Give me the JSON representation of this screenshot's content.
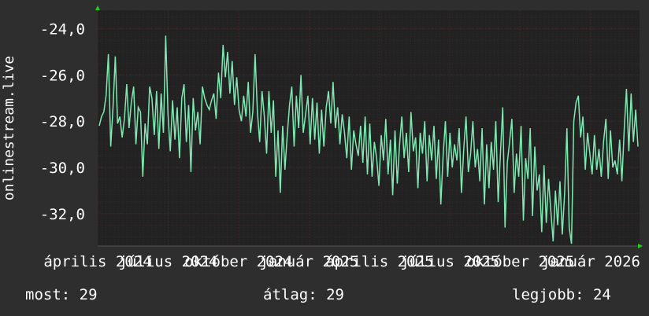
{
  "chart_data": {
    "type": "line",
    "ylabel": "onlinestream.live",
    "ylim": [
      -33.4,
      -23.2
    ],
    "y_ticks": [
      -24,
      -26,
      -28,
      -30,
      -32
    ],
    "y_tick_labels": [
      "-24,0",
      "-26,0",
      "-28,0",
      "-30,0",
      "-32,0"
    ],
    "x_tick_labels": [
      "április 2024",
      "július 2024",
      "október 2024",
      "január 2025",
      "április 2025",
      "július 2025",
      "október 2025",
      "január 2026"
    ],
    "x_ticks": [
      0,
      13,
      26,
      39,
      52,
      65,
      78,
      91
    ],
    "x_range": [
      0,
      100
    ],
    "grid": true,
    "series": [
      {
        "color": "#7fe8b2",
        "values": [
          -28.2,
          -27.8,
          -27.6,
          -26.9,
          -25.1,
          -29.1,
          -27.4,
          -25.2,
          -28.1,
          -27.8,
          -28.7,
          -27.9,
          -26.4,
          -28.3,
          -27.2,
          -26.5,
          -29.0,
          -27.4,
          -27.6,
          -30.4,
          -28.1,
          -29.0,
          -26.5,
          -27.0,
          -28.6,
          -26.7,
          -29.2,
          -26.8,
          -28.5,
          -24.3,
          -27.7,
          -29.3,
          -27.1,
          -28.8,
          -27.4,
          -29.6,
          -27.0,
          -26.4,
          -28.9,
          -27.3,
          -30.2,
          -27.0,
          -28.4,
          -27.6,
          -29.0,
          -26.5,
          -27.0,
          -27.3,
          -27.5,
          -27.1,
          -26.8,
          -27.9,
          -25.9,
          -27.0,
          -24.7,
          -26.1,
          -25.0,
          -26.8,
          -25.4,
          -27.3,
          -26.1,
          -27.5,
          -28.0,
          -26.9,
          -27.8,
          -26.3,
          -28.5,
          -27.6,
          -25.1,
          -27.6,
          -28.9,
          -26.7,
          -27.8,
          -29.4,
          -26.7,
          -28.5,
          -27.1,
          -30.4,
          -28.4,
          -31.1,
          -28.2,
          -30.1,
          -28.6,
          -27.3,
          -26.5,
          -29.1,
          -26.9,
          -28.3,
          -26.0,
          -28.5,
          -27.7,
          -26.9,
          -29.0,
          -27.0,
          -28.8,
          -27.2,
          -29.4,
          -27.5,
          -29.1,
          -27.4,
          -26.7,
          -28.1,
          -26.3,
          -28.3,
          -27.4,
          -29.0,
          -27.7,
          -28.5,
          -29.6,
          -27.8,
          -30.1,
          -28.4,
          -29.0,
          -29.5,
          -28.2,
          -29.8,
          -27.8,
          -30.3,
          -28.1,
          -30.4,
          -28.9,
          -29.6,
          -30.8,
          -28.6,
          -29.7,
          -27.9,
          -30.3,
          -28.8,
          -31.2,
          -28.4,
          -30.7,
          -29.0,
          -27.8,
          -29.6,
          -28.5,
          -30.2,
          -27.6,
          -29.3,
          -28.7,
          -30.9,
          -28.5,
          -29.4,
          -28.0,
          -30.6,
          -28.6,
          -29.7,
          -28.2,
          -30.5,
          -28.8,
          -31.6,
          -29.5,
          -28.0,
          -30.4,
          -28.5,
          -30.0,
          -29.0,
          -29.7,
          -28.3,
          -31.1,
          -29.2,
          -27.8,
          -30.2,
          -29.4,
          -28.0,
          -30.0,
          -29.2,
          -30.6,
          -28.3,
          -31.6,
          -29.0,
          -30.9,
          -28.9,
          -30.1,
          -28.0,
          -31.5,
          -29.4,
          -27.4,
          -32.6,
          -29.8,
          -28.9,
          -27.9,
          -31.1,
          -29.4,
          -30.4,
          -28.2,
          -32.3,
          -29.6,
          -30.5,
          -28.3,
          -32.1,
          -29.1,
          -31.0,
          -30.3,
          -32.8,
          -29.9,
          -32.4,
          -30.5,
          -31.9,
          -33.2,
          -31.0,
          -32.5,
          -30.6,
          -32.9,
          -31.1,
          -28.3,
          -32.6,
          -33.3,
          -28.0,
          -27.2,
          -26.9,
          -28.7,
          -27.8,
          -30.1,
          -28.5,
          -29.4,
          -30.3,
          -28.6,
          -30.1,
          -29.2,
          -30.4,
          -28.9,
          -27.9,
          -30.5,
          -28.4,
          -30.0,
          -29.7,
          -30.3,
          -28.8,
          -30.6,
          -28.4,
          -26.6,
          -29.3,
          -26.8,
          -28.9,
          -27.5,
          -29.1
        ]
      }
    ]
  },
  "footer": {
    "current": "most: 29",
    "average": "átlag: 29",
    "best": "legjobb: 24"
  },
  "colors": {
    "background": "#2e2e2e",
    "plot_background": "#222222",
    "grid_major": "#3f2727",
    "grid_minor": "#332a2a",
    "line": "#7fe8b2",
    "axis_arrow": "#20d020",
    "text": "#ffffff"
  }
}
